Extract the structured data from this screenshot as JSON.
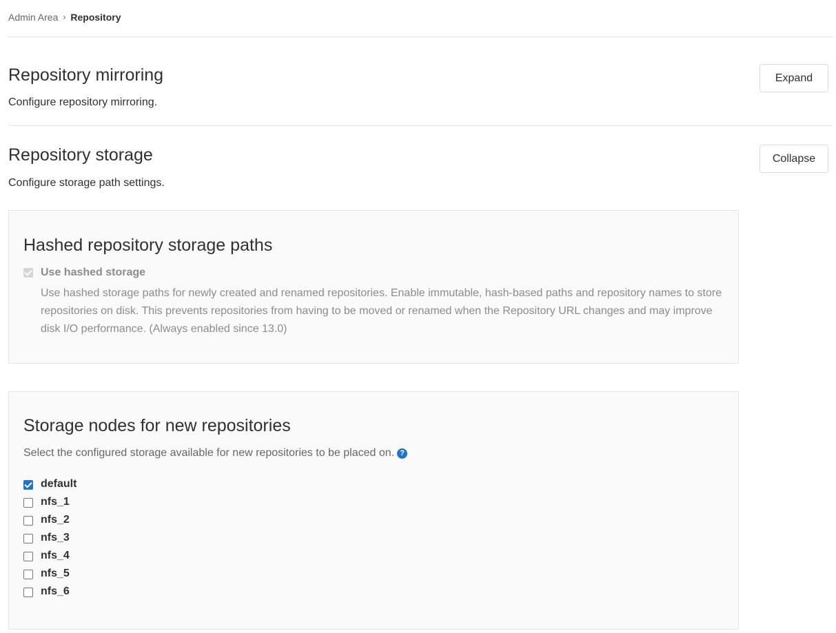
{
  "breadcrumb": {
    "parent": "Admin Area",
    "current": "Repository"
  },
  "mirroring": {
    "title": "Repository mirroring",
    "description": "Configure repository mirroring.",
    "toggle_label": "Expand"
  },
  "storage": {
    "title": "Repository storage",
    "description": "Configure storage path settings.",
    "toggle_label": "Collapse",
    "hashed": {
      "title": "Hashed repository storage paths",
      "checkbox_label": "Use hashed storage",
      "checked": true,
      "disabled": true,
      "help": "Use hashed storage paths for newly created and renamed repositories. Enable immutable, hash-based paths and repository names to store repositories on disk. This prevents repositories from having to be moved or renamed when the Repository URL changes and may improve disk I/O performance. (Always enabled since 13.0)"
    },
    "nodes": {
      "title": "Storage nodes for new repositories",
      "description": "Select the configured storage available for new repositories to be placed on.",
      "help_icon": "question-circle-icon",
      "items": [
        {
          "label": "default",
          "checked": true
        },
        {
          "label": "nfs_1",
          "checked": false
        },
        {
          "label": "nfs_2",
          "checked": false
        },
        {
          "label": "nfs_3",
          "checked": false
        },
        {
          "label": "nfs_4",
          "checked": false
        },
        {
          "label": "nfs_5",
          "checked": false
        },
        {
          "label": "nfs_6",
          "checked": false
        }
      ]
    }
  },
  "colors": {
    "accent": "#1f75cb",
    "text": "#303030",
    "muted": "#8c8c8c",
    "border": "#e5e5e5",
    "panel_bg": "#fafafa"
  }
}
